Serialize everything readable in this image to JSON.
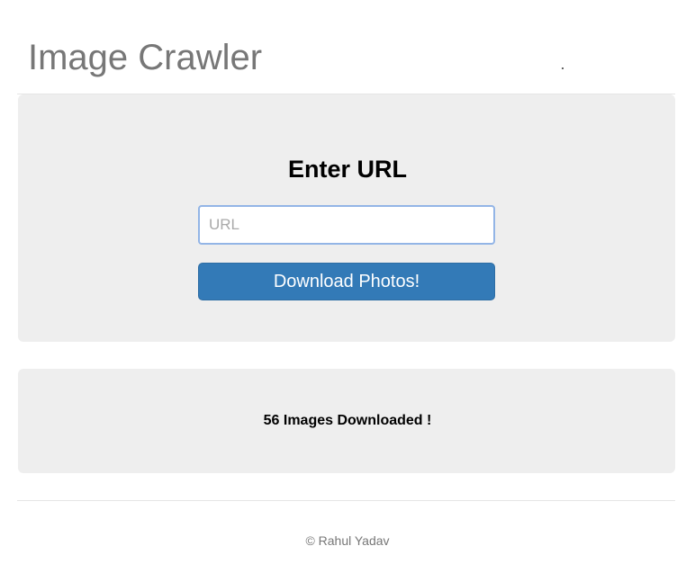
{
  "header": {
    "title": "Image Crawler"
  },
  "form": {
    "heading": "Enter URL",
    "url_placeholder": "URL",
    "url_value": "",
    "submit_label": "Download Photos!"
  },
  "result": {
    "message": "56 Images Downloaded !"
  },
  "footer": {
    "text": "© Rahul Yadav"
  },
  "colors": {
    "primary_button": "#337ab7",
    "panel_background": "#eeeeee",
    "input_focus_border": "#93b5e6",
    "muted_text": "#777777"
  }
}
